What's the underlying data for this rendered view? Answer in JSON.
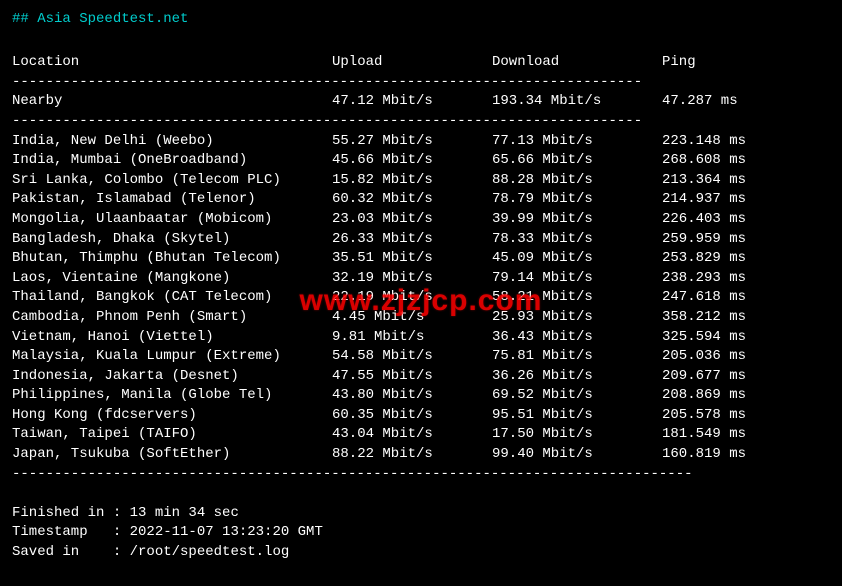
{
  "header": "## Asia Speedtest.net",
  "columns": {
    "location": "Location",
    "upload": "Upload",
    "download": "Download",
    "ping": "Ping"
  },
  "nearby": {
    "location": "Nearby",
    "upload": "47.12 Mbit/s",
    "download": "193.34 Mbit/s",
    "ping": "47.287 ms"
  },
  "rows": [
    {
      "location": "India, New Delhi (Weebo)",
      "upload": "55.27 Mbit/s",
      "download": "77.13 Mbit/s",
      "ping": "223.148 ms"
    },
    {
      "location": "India, Mumbai (OneBroadband)",
      "upload": "45.66 Mbit/s",
      "download": "65.66 Mbit/s",
      "ping": "268.608 ms"
    },
    {
      "location": "Sri Lanka, Colombo (Telecom PLC)",
      "upload": "15.82 Mbit/s",
      "download": "88.28 Mbit/s",
      "ping": "213.364 ms"
    },
    {
      "location": "Pakistan, Islamabad (Telenor)",
      "upload": "60.32 Mbit/s",
      "download": "78.79 Mbit/s",
      "ping": "214.937 ms"
    },
    {
      "location": "Mongolia, Ulaanbaatar (Mobicom)",
      "upload": "23.03 Mbit/s",
      "download": "39.99 Mbit/s",
      "ping": "226.403 ms"
    },
    {
      "location": "Bangladesh, Dhaka (Skytel)",
      "upload": "26.33 Mbit/s",
      "download": "78.33 Mbit/s",
      "ping": "259.959 ms"
    },
    {
      "location": "Bhutan, Thimphu (Bhutan Telecom)",
      "upload": "35.51 Mbit/s",
      "download": "45.09 Mbit/s",
      "ping": "253.829 ms"
    },
    {
      "location": "Laos, Vientaine (Mangkone)",
      "upload": "32.19 Mbit/s",
      "download": "79.14 Mbit/s",
      "ping": "238.293 ms"
    },
    {
      "location": "Thailand, Bangkok (CAT Telecom)",
      "upload": "22.19 Mbit/s",
      "download": "58.21 Mbit/s",
      "ping": "247.618 ms"
    },
    {
      "location": "Cambodia, Phnom Penh (Smart)",
      "upload": "4.45 Mbit/s",
      "download": "25.93 Mbit/s",
      "ping": "358.212 ms"
    },
    {
      "location": "Vietnam, Hanoi (Viettel)",
      "upload": "9.81 Mbit/s",
      "download": "36.43 Mbit/s",
      "ping": "325.594 ms"
    },
    {
      "location": "Malaysia, Kuala Lumpur (Extreme)",
      "upload": "54.58 Mbit/s",
      "download": "75.81 Mbit/s",
      "ping": "205.036 ms"
    },
    {
      "location": "Indonesia, Jakarta (Desnet)",
      "upload": "47.55 Mbit/s",
      "download": "36.26 Mbit/s",
      "ping": "209.677 ms"
    },
    {
      "location": "Philippines, Manila (Globe Tel)",
      "upload": "43.80 Mbit/s",
      "download": "69.52 Mbit/s",
      "ping": "208.869 ms"
    },
    {
      "location": "Hong Kong (fdcservers)",
      "upload": "60.35 Mbit/s",
      "download": "95.51 Mbit/s",
      "ping": "205.578 ms"
    },
    {
      "location": "Taiwan, Taipei (TAIFO)",
      "upload": "43.04 Mbit/s",
      "download": "17.50 Mbit/s",
      "ping": "181.549 ms"
    },
    {
      "location": "Japan, Tsukuba (SoftEther)",
      "upload": "88.22 Mbit/s",
      "download": "99.40 Mbit/s",
      "ping": "160.819 ms"
    }
  ],
  "footer": {
    "finished_label": "Finished in : ",
    "finished_value": "13 min 34 sec",
    "timestamp_label": "Timestamp   : ",
    "timestamp_value": "2022-11-07 13:23:20 GMT",
    "saved_label": "Saved in    : ",
    "saved_value": "/root/speedtest.log"
  },
  "dashes_short": "---------------------------------------------------------------------------",
  "dashes_long": "---------------------------------------------------------------------------------",
  "watermark": "www.zjzjcp.com"
}
